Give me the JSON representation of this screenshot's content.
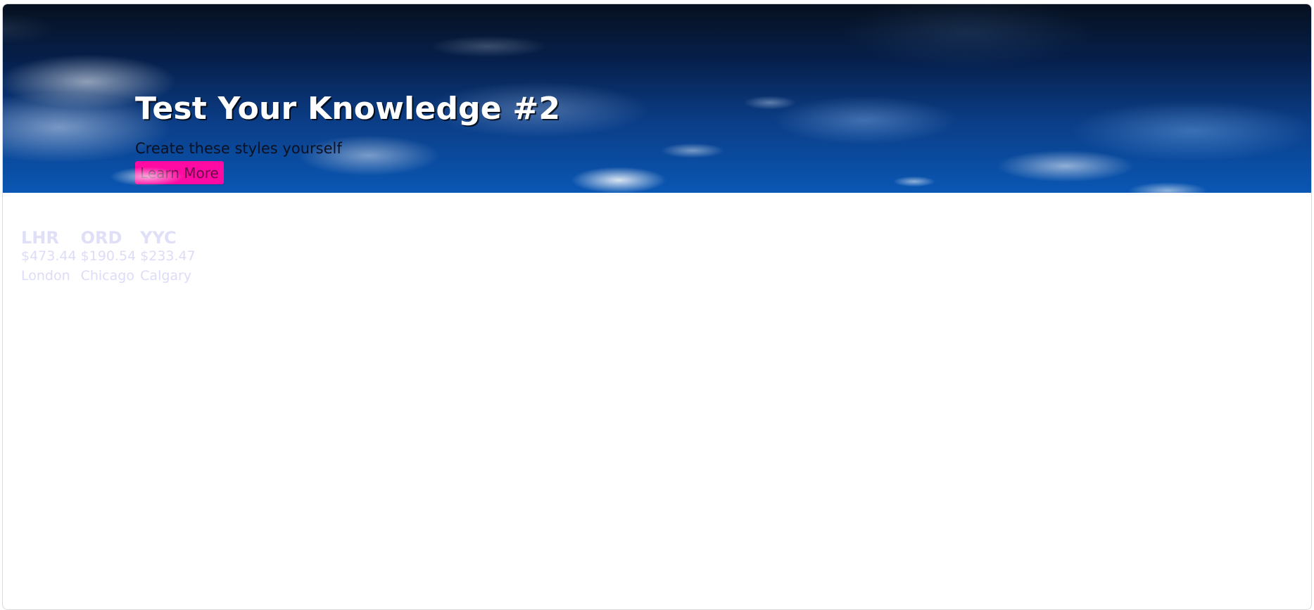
{
  "hero": {
    "title": "Test Your Knowledge #2",
    "subtitle": "Create these styles yourself",
    "button_label": "Learn More"
  },
  "airports": [
    {
      "code": "LHR",
      "price": "$473.44",
      "city": "London"
    },
    {
      "code": "ORD",
      "price": "$190.54",
      "city": "Chicago"
    },
    {
      "code": "YYC",
      "price": "$233.47",
      "city": "Calgary"
    }
  ]
}
